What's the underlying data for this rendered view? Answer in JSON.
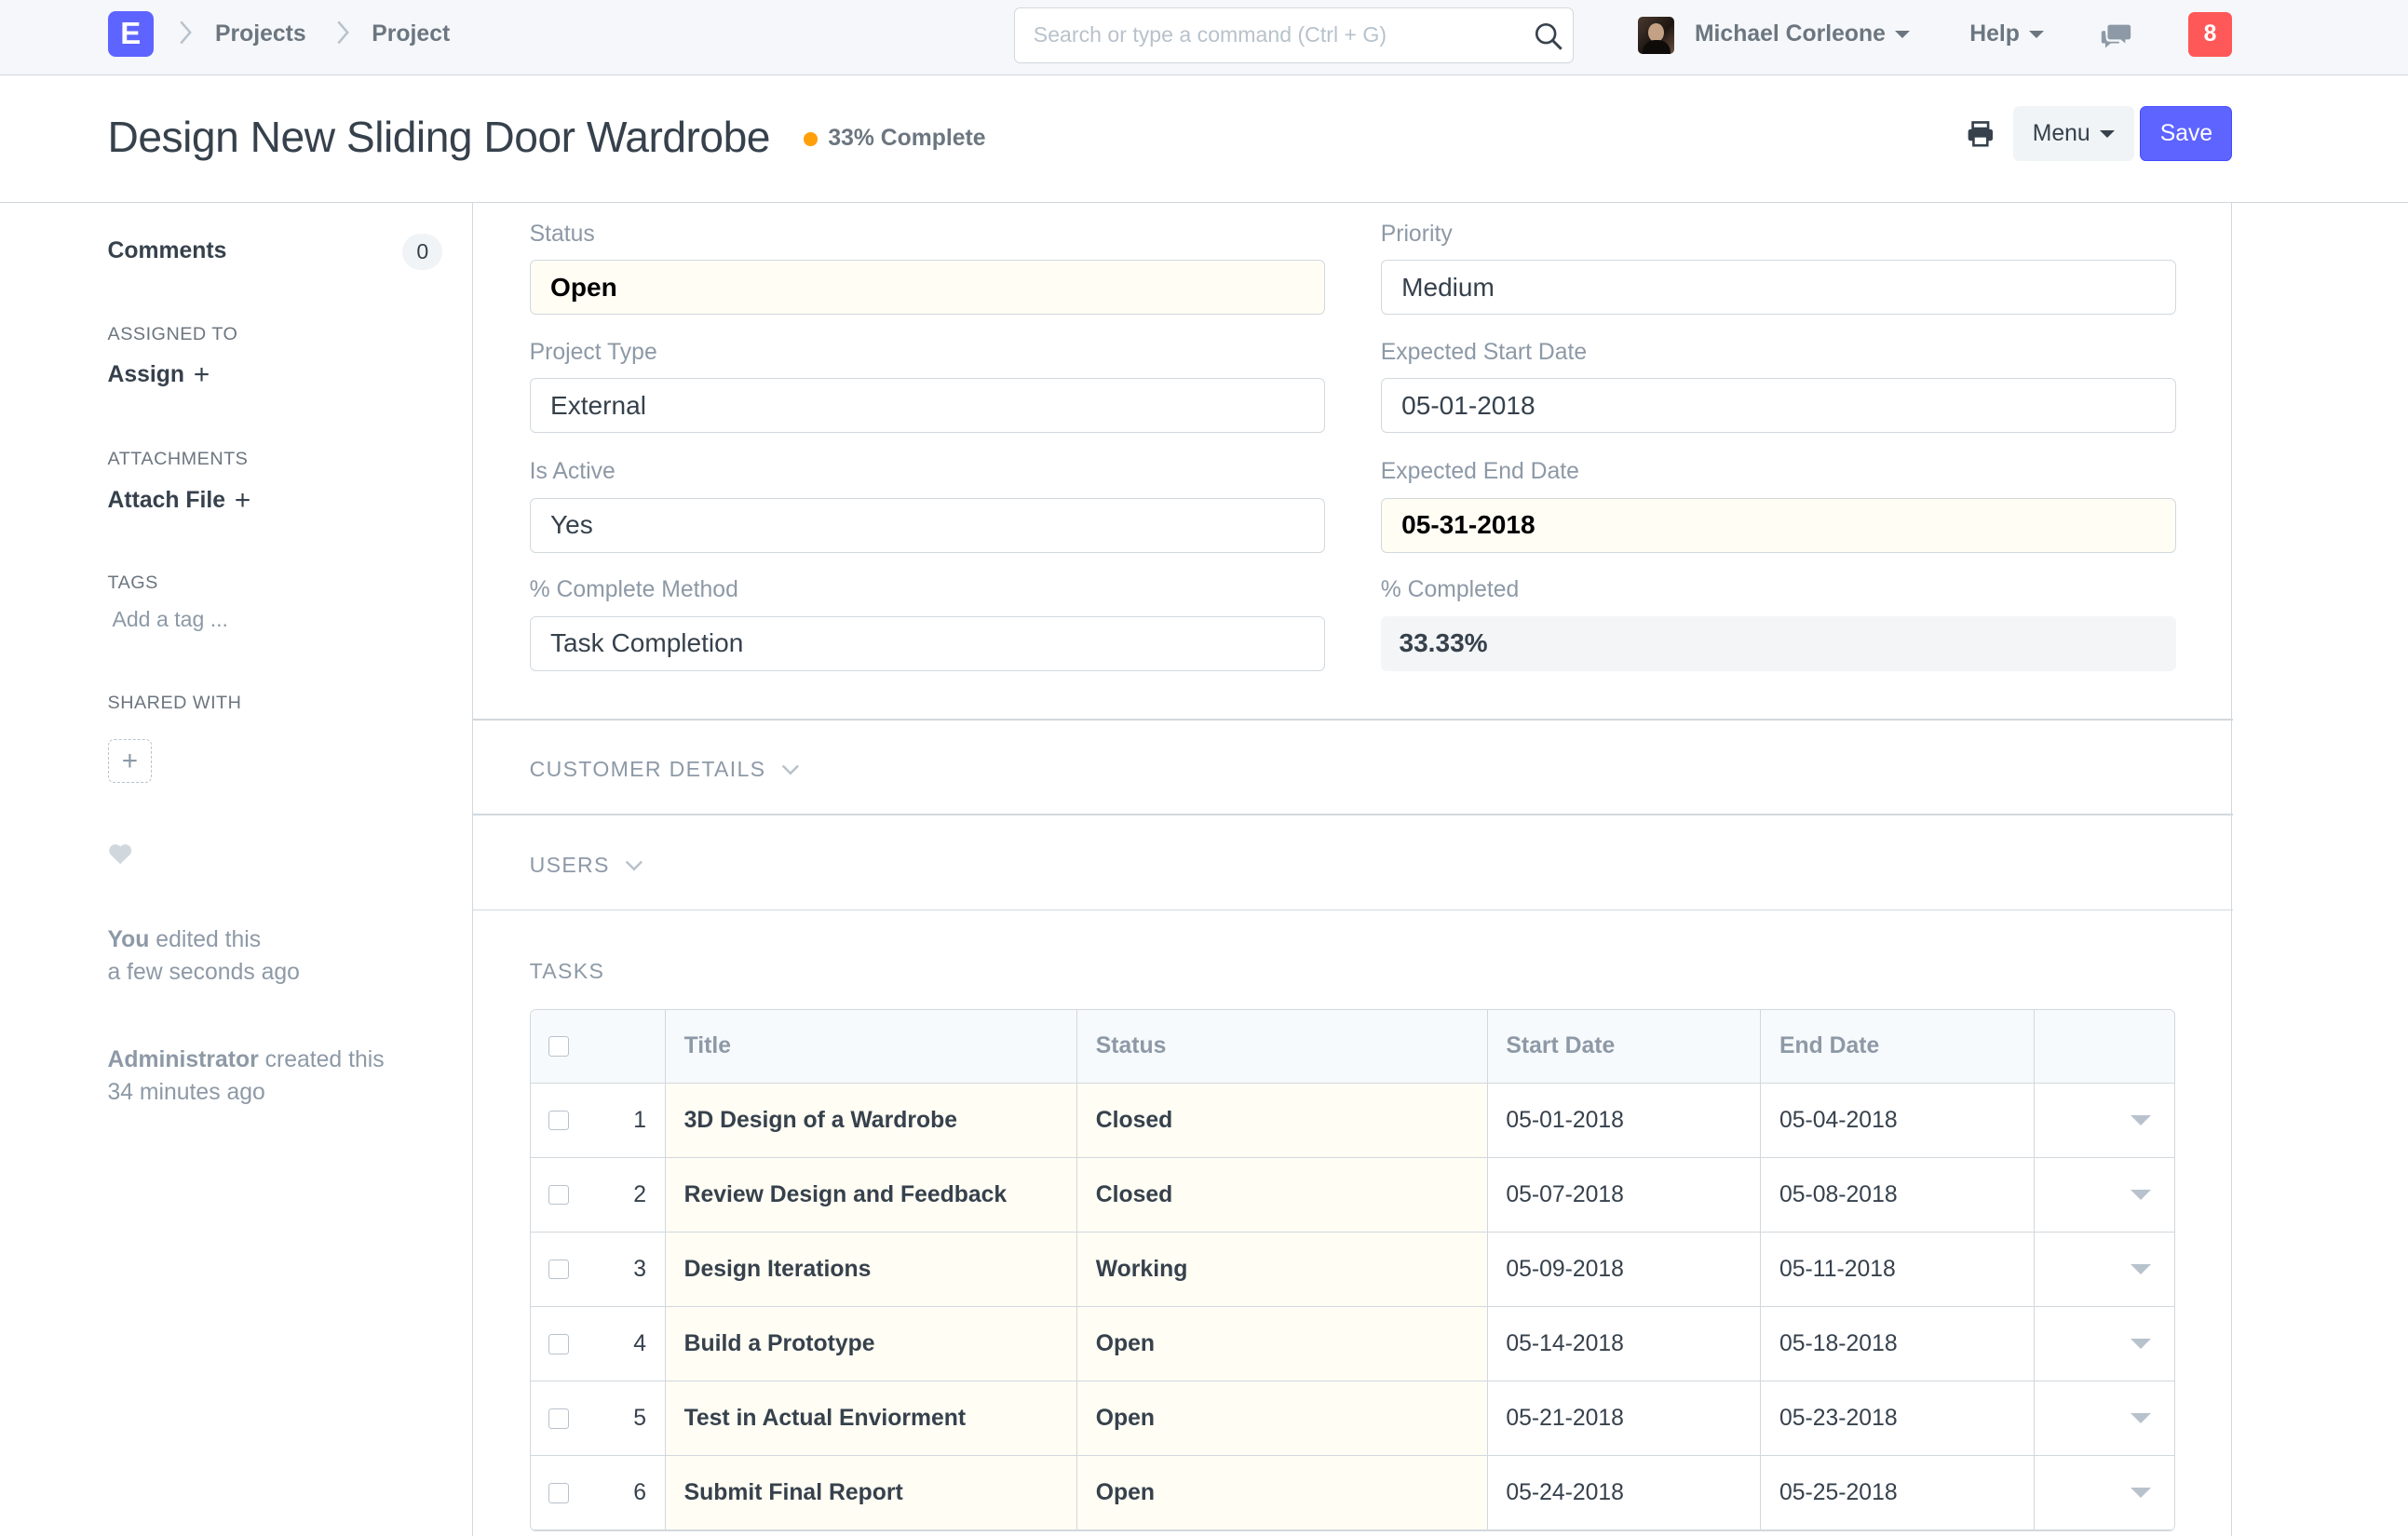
{
  "navbar": {
    "logo": "E",
    "breadcrumbs": [
      "Projects",
      "Project"
    ],
    "search_placeholder": "Search or type a command (Ctrl + G)",
    "user_name": "Michael Corleone",
    "help_label": "Help",
    "notification_count": "8"
  },
  "page": {
    "title": "Design New Sliding Door Wardrobe",
    "indicator": "33% Complete",
    "indicator_color": "#ffa00a",
    "menu_label": "Menu",
    "save_label": "Save"
  },
  "sidebar": {
    "comments_label": "Comments",
    "comments_count": "0",
    "assigned_to_label": "ASSIGNED TO",
    "assign_label": "Assign",
    "attachments_label": "ATTACHMENTS",
    "attach_label": "Attach File",
    "tags_label": "TAGS",
    "tag_placeholder": "Add a tag ...",
    "shared_with_label": "SHARED WITH",
    "activity": [
      {
        "user": "You",
        "action": " edited this",
        "time": "a few seconds ago"
      },
      {
        "user": "Administrator",
        "action": " created this",
        "time": "34 minutes ago"
      }
    ]
  },
  "form": {
    "status": {
      "label": "Status",
      "value": "Open"
    },
    "priority": {
      "label": "Priority",
      "value": "Medium"
    },
    "project_type": {
      "label": "Project Type",
      "value": "External"
    },
    "expected_start_date": {
      "label": "Expected Start Date",
      "value": "05-01-2018"
    },
    "is_active": {
      "label": "Is Active",
      "value": "Yes"
    },
    "expected_end_date": {
      "label": "Expected End Date",
      "value": "05-31-2018"
    },
    "complete_method": {
      "label": "% Complete Method",
      "value": "Task Completion"
    },
    "percent_completed": {
      "label": "% Completed",
      "value": "33.33%"
    }
  },
  "sections": {
    "customer_details": "CUSTOMER DETAILS",
    "users": "USERS",
    "tasks": "TASKS"
  },
  "tasks_table": {
    "headers": [
      "Title",
      "Status",
      "Start Date",
      "End Date"
    ],
    "rows": [
      {
        "idx": "1",
        "title": "3D Design of a Wardrobe",
        "status": "Closed",
        "start": "05-01-2018",
        "end": "05-04-2018"
      },
      {
        "idx": "2",
        "title": "Review Design and Feedback",
        "status": "Closed",
        "start": "05-07-2018",
        "end": "05-08-2018"
      },
      {
        "idx": "3",
        "title": "Design Iterations",
        "status": "Working",
        "start": "05-09-2018",
        "end": "05-11-2018"
      },
      {
        "idx": "4",
        "title": "Build a Prototype",
        "status": "Open",
        "start": "05-14-2018",
        "end": "05-18-2018"
      },
      {
        "idx": "5",
        "title": "Test in Actual Enviorment",
        "status": "Open",
        "start": "05-21-2018",
        "end": "05-23-2018"
      },
      {
        "idx": "6",
        "title": "Submit Final Report",
        "status": "Open",
        "start": "05-24-2018",
        "end": "05-25-2018"
      }
    ]
  },
  "colors": {
    "primary": "#5e64ff",
    "notification": "#ff5858",
    "required_field_bg": "#fffdf4"
  }
}
